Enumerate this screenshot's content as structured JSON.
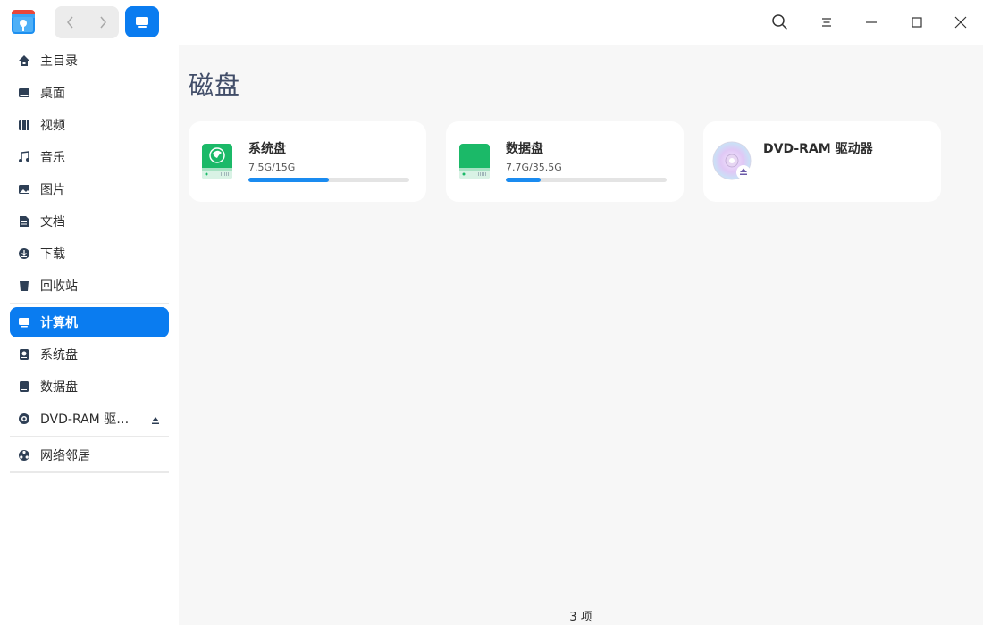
{
  "titlebar": {
    "icons": [
      "file-manager-logo",
      "back-icon",
      "forward-icon",
      "computer-view-icon",
      "search-icon",
      "menu-icon",
      "minimize-icon",
      "maximize-icon",
      "close-icon"
    ]
  },
  "sidebar": {
    "items": [
      {
        "label": "主目录",
        "icon": "home-icon"
      },
      {
        "label": "桌面",
        "icon": "desktop-icon"
      },
      {
        "label": "视频",
        "icon": "video-icon"
      },
      {
        "label": "音乐",
        "icon": "music-icon"
      },
      {
        "label": "图片",
        "icon": "picture-icon"
      },
      {
        "label": "文档",
        "icon": "document-icon"
      },
      {
        "label": "下载",
        "icon": "download-icon"
      },
      {
        "label": "回收站",
        "icon": "trash-icon"
      },
      {
        "label": "计算机",
        "icon": "computer-icon",
        "active": true
      },
      {
        "label": "系统盘",
        "icon": "system-disk-icon"
      },
      {
        "label": "数据盘",
        "icon": "data-disk-icon"
      },
      {
        "label": "DVD-RAM 驱…",
        "icon": "dvd-icon",
        "eject": true
      },
      {
        "label": "网络邻居",
        "icon": "network-icon"
      }
    ]
  },
  "main": {
    "title": "磁盘",
    "disks": [
      {
        "name": "系统盘",
        "usage": "7.5G/15G",
        "fraction": 0.5,
        "icon": "system-disk-icon"
      },
      {
        "name": "数据盘",
        "usage": "7.7G/35.5G",
        "fraction": 0.217,
        "icon": "data-disk-icon"
      },
      {
        "name": "DVD-RAM 驱动器",
        "icon": "dvd-drive-icon"
      }
    ]
  },
  "status": {
    "count": "3 项"
  },
  "colors": {
    "accent": "#0a7cf0",
    "disk_green": "#1bb968",
    "progress": "#1a8bf0",
    "title_text": "#414d68"
  }
}
